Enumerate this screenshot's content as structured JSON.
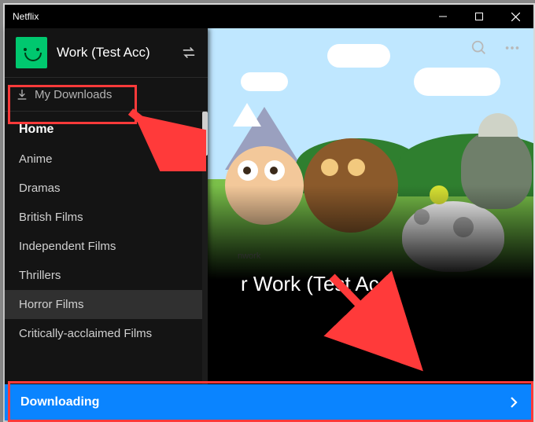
{
  "window": {
    "title": "Netflix"
  },
  "profile": {
    "name": "Work (Test Acc)"
  },
  "downloads": {
    "label": "My Downloads"
  },
  "categories": [
    {
      "label": "Home",
      "active": true
    },
    {
      "label": "Anime"
    },
    {
      "label": "Dramas"
    },
    {
      "label": "British Films"
    },
    {
      "label": "Independent Films"
    },
    {
      "label": "Thrillers"
    },
    {
      "label": "Horror Films",
      "hovered": true
    },
    {
      "label": "Critically-acclaimed Films"
    }
  ],
  "content": {
    "heading_visible": "r Work (Test Acc)",
    "watermark": "nwork"
  },
  "bottom": {
    "status": "Downloading"
  }
}
